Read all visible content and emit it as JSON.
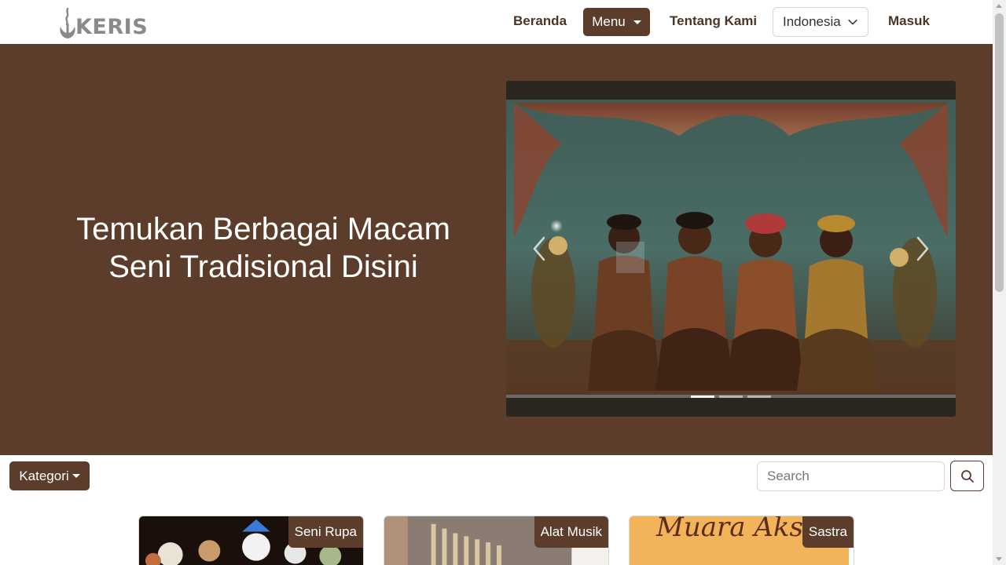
{
  "brand": {
    "name": "KERIS",
    "logo_icon": "keris-flame-icon"
  },
  "nav": {
    "beranda": "Beranda",
    "menu": "Menu",
    "tentang": "Tentang Kami",
    "language": "Indonesia",
    "masuk": "Masuk"
  },
  "hero": {
    "title_line1": "Temukan Berbagai Macam",
    "title_line2": "Seni Tradisional Disini",
    "carousel": {
      "slide_count": 3,
      "active_slide": 1
    }
  },
  "filter": {
    "kategori": "Kategori",
    "search_placeholder": "Search",
    "search_icon": "search-icon"
  },
  "cards": [
    {
      "badge": "Seni Rupa"
    },
    {
      "badge": "Alat Musik"
    },
    {
      "badge": "Sastra",
      "image_text": "Muara Aksar"
    }
  ],
  "colors": {
    "brand_brown": "#5c3d2b",
    "nav_text": "#4d3526",
    "logo_gray": "#8a8a8a",
    "white": "#ffffff"
  }
}
